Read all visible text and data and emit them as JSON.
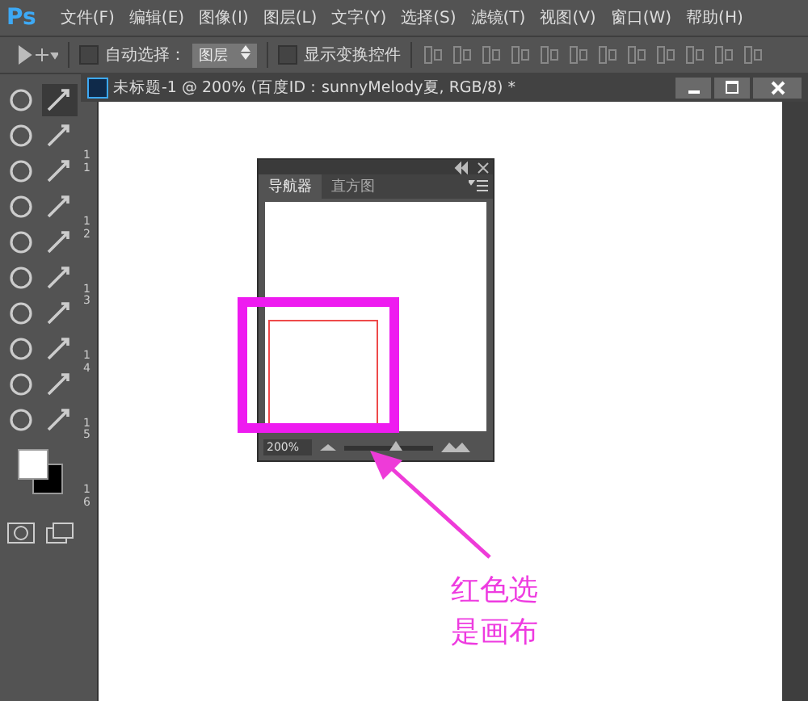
{
  "menu_bar": {
    "logo": "Ps",
    "items": [
      "文件(F)",
      "编辑(E)",
      "图像(I)",
      "图层(L)",
      "文字(Y)",
      "选择(S)",
      "滤镜(T)",
      "视图(V)",
      "窗口(W)",
      "帮助(H)"
    ]
  },
  "options_bar": {
    "auto_select": {
      "label": "自动选择：",
      "checked": false
    },
    "target_dropdown": "图层",
    "show_transform": {
      "label": "显示变换控件",
      "checked": false
    }
  },
  "toolbox": {
    "tools": [
      {
        "selected": false
      },
      {
        "selected": true
      },
      {
        "selected": false
      },
      {
        "selected": false
      },
      {
        "selected": false
      },
      {
        "selected": false
      },
      {
        "selected": false
      },
      {
        "selected": false
      },
      {
        "selected": false
      },
      {
        "selected": false
      },
      {
        "selected": false
      },
      {
        "selected": false
      },
      {
        "selected": false
      },
      {
        "selected": false
      },
      {
        "selected": false
      },
      {
        "selected": false
      },
      {
        "selected": false
      },
      {
        "selected": false
      },
      {
        "selected": false
      },
      {
        "selected": false
      }
    ]
  },
  "document": {
    "tab_title": "未标题-1 @ 200% (百度ID：sunnyMelody夏, RGB/8) *",
    "ruler_labels": [
      "11",
      "12",
      "13",
      "14",
      "15",
      "16"
    ]
  },
  "navigator_panel": {
    "tabs": [
      {
        "label": "导航器",
        "selected": true
      },
      {
        "label": "直方图",
        "selected": false
      }
    ],
    "zoom": "200%",
    "zoom_slider": {
      "level": 0.58
    }
  },
  "annotation": {
    "lines": [
      "红色选",
      "是画布"
    ]
  }
}
